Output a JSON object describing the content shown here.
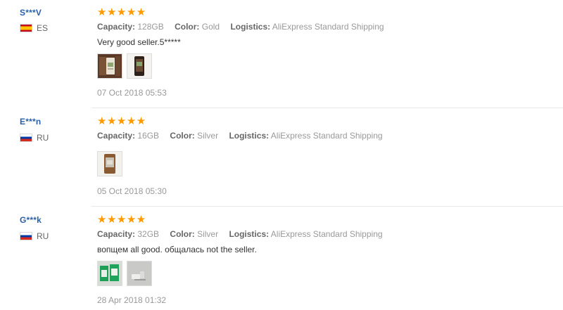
{
  "labels": {
    "capacity": "Capacity:",
    "color": "Color:",
    "logistics": "Logistics:"
  },
  "rating_color": "#ff9a00",
  "reviews": [
    {
      "buyer": "S***V",
      "country_code": "ES",
      "rating": 5,
      "stars": "★★★★★",
      "capacity": "128GB",
      "color": "Gold",
      "logistics": "AliExpress Standard Shipping",
      "comment": "Very good seller.5*****",
      "photo_count": 2,
      "date": "07 Oct 2018 05:53"
    },
    {
      "buyer": "E***n",
      "country_code": "RU",
      "rating": 5,
      "stars": "★★★★★",
      "capacity": "16GB",
      "color": "Silver",
      "logistics": "AliExpress Standard Shipping",
      "comment": "",
      "photo_count": 1,
      "date": "05 Oct 2018 05:30"
    },
    {
      "buyer": "G***k",
      "country_code": "RU",
      "rating": 5,
      "stars": "★★★★★",
      "capacity": "32GB",
      "color": "Silver",
      "logistics": "AliExpress Standard Shipping",
      "comment": "вопщем all good. общалась not the seller.",
      "photo_count": 2,
      "date": "28 Apr 2018 01:32"
    }
  ]
}
